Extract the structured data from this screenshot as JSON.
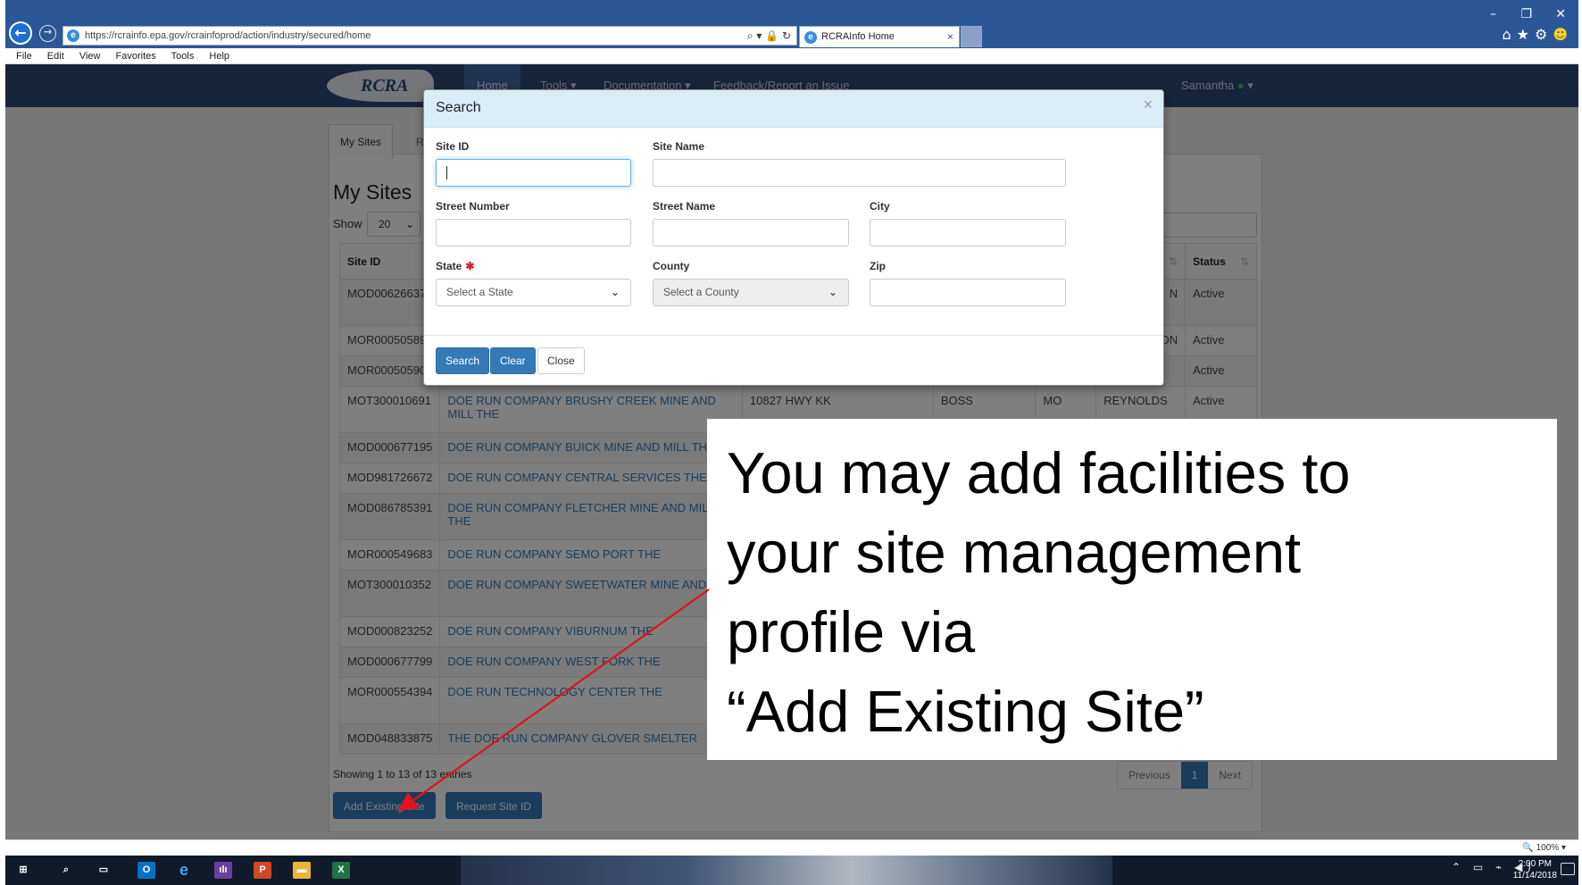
{
  "browser": {
    "url": "https://rcrainfo.epa.gov/rcrainfoprod/action/industry/secured/home",
    "tab_title": "RCRAInfo Home",
    "menu": [
      "File",
      "Edit",
      "View",
      "Favorites",
      "Tools",
      "Help"
    ],
    "zoom": "100%"
  },
  "site_nav": {
    "logo": "RCRA",
    "items": [
      "Home",
      "Tools ▾",
      "Documentation ▾",
      "Feedback/Report an Issue"
    ],
    "user": "Samantha"
  },
  "page": {
    "tabs": [
      "My Sites",
      "Re"
    ],
    "title": "My Sites",
    "show_label": "Show",
    "show_value": "20",
    "columns": [
      "Site ID",
      "Status"
    ],
    "rows": [
      {
        "id": "MOD006266373",
        "name": "",
        "address": "",
        "city": "",
        "state": "",
        "county": "N",
        "status": "Active"
      },
      {
        "id": "MOR000505891",
        "name": "",
        "address": "",
        "city": "",
        "state": "",
        "county": "ON",
        "status": "Active"
      },
      {
        "id": "MOR000505909",
        "name": "",
        "address": "",
        "city": "",
        "state": "",
        "county": "",
        "status": "Active"
      },
      {
        "id": "MOT300010691",
        "name": "DOE RUN COMPANY BRUSHY CREEK MINE AND MILL THE",
        "address": "10827 HWY KK",
        "city": "BOSS",
        "state": "MO",
        "county": "REYNOLDS",
        "status": "Active"
      },
      {
        "id": "MOD000677195",
        "name": "DOE RUN COMPANY BUICK MINE AND MILL THE",
        "address": "",
        "city": "",
        "state": "",
        "county": "",
        "status": ""
      },
      {
        "id": "MOD981726672",
        "name": "DOE RUN COMPANY CENTRAL SERVICES THE",
        "address": "",
        "city": "",
        "state": "",
        "county": "",
        "status": ""
      },
      {
        "id": "MOD086785391",
        "name": "DOE RUN COMPANY FLETCHER MINE AND MILL THE",
        "address": "",
        "city": "",
        "state": "",
        "county": "",
        "status": ""
      },
      {
        "id": "MOR000549683",
        "name": "DOE RUN COMPANY SEMO PORT THE",
        "address": "",
        "city": "",
        "state": "",
        "county": "",
        "status": ""
      },
      {
        "id": "MOT300010352",
        "name": "DOE RUN COMPANY SWEETWATER MINE AND THE",
        "address": "",
        "city": "",
        "state": "",
        "county": "",
        "status": ""
      },
      {
        "id": "MOD000823252",
        "name": "DOE RUN COMPANY VIBURNUM THE",
        "address": "",
        "city": "",
        "state": "",
        "county": "",
        "status": ""
      },
      {
        "id": "MOD000677799",
        "name": "DOE RUN COMPANY WEST FORK THE",
        "address": "",
        "city": "",
        "state": "",
        "county": "",
        "status": ""
      },
      {
        "id": "MOR000554394",
        "name": "DOE RUN TECHNOLOGY CENTER THE",
        "address": "",
        "city": "",
        "state": "",
        "county": "",
        "status": ""
      },
      {
        "id": "MOD048833875",
        "name": "THE DOE RUN COMPANY GLOVER SMELTER",
        "address": "",
        "city": "",
        "state": "",
        "county": "",
        "status": ""
      }
    ],
    "entries_info": "Showing 1 to 13 of 13 entries",
    "pager": {
      "previous": "Previous",
      "current": "1",
      "next": "Next"
    },
    "add_existing_site": "Add Existing Site",
    "request_site_id": "Request Site ID"
  },
  "modal": {
    "title": "Search",
    "close_x": "×",
    "labels": {
      "site_id": "Site ID",
      "site_name": "Site Name",
      "street_number": "Street Number",
      "street_name": "Street Name",
      "city": "City",
      "state": "State",
      "county": "County",
      "zip": "Zip"
    },
    "state_placeholder": "Select a State",
    "county_placeholder": "Select a County",
    "buttons": {
      "search": "Search",
      "clear": "Clear",
      "close": "Close"
    }
  },
  "annotation": {
    "text": "You may add facilities to\nyour site management\nprofile via\n“Add Existing Site”",
    "arrow_color": "#e0141e"
  },
  "taskbar": {
    "time": "2:00 PM",
    "date": "11/14/2018"
  },
  "colors": {
    "browser_blue": "#2b5797",
    "site_nav": "#2d4a77",
    "primary": "#337ab7",
    "modal_header": "#d9edf7",
    "required": "#d9202a"
  }
}
